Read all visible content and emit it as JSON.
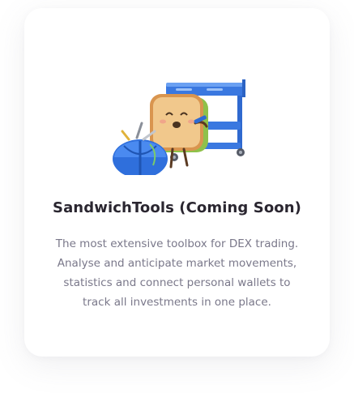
{
  "card": {
    "title": "SandwichTools (Coming Soon)",
    "description_lines": [
      "The most extensive toolbox for DEX trading.",
      "Analyse and anticipate market movements,",
      "statistics and connect personal wallets to",
      "track all investments in one place."
    ],
    "illustration_icon": "sandwich-toolcart-illustration"
  },
  "colors": {
    "title": "#2a2630",
    "description": "#7a788a",
    "cart_blue": "#3a78e0",
    "bread": "#e9b774"
  }
}
